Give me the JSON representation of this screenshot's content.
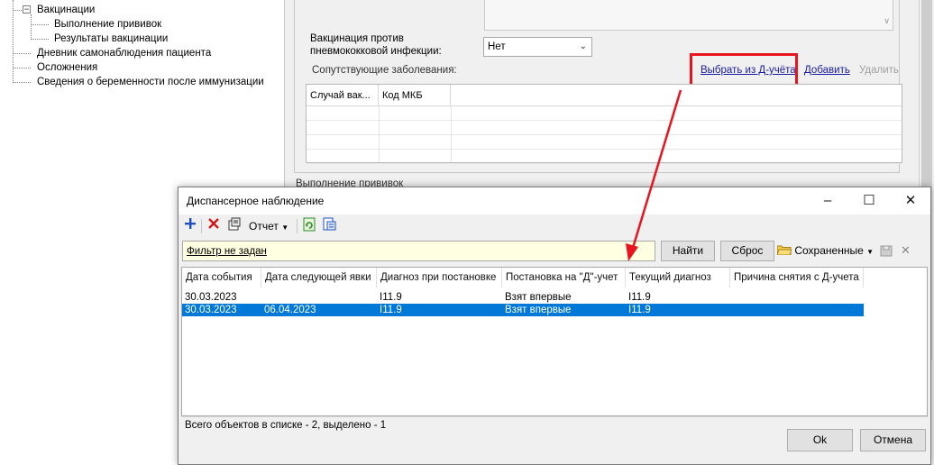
{
  "tree": {
    "items": [
      {
        "label": "Вакцинации",
        "level": 1
      },
      {
        "label": "Выполнение прививок",
        "level": 2
      },
      {
        "label": "Результаты вакцинации",
        "level": 2
      },
      {
        "label": "Дневник самонаблюдения пациента",
        "level": 1
      },
      {
        "label": "Осложнения",
        "level": 1
      },
      {
        "label": "Сведения о беременности после иммунизации",
        "level": 1
      }
    ],
    "expander_symbol": "−"
  },
  "form": {
    "vaccination_label": "Вакцинация против пневмококковой инфекции:",
    "vaccination_value": "Нет",
    "comorbidities_label": "Сопутствующие заболевания:",
    "link_select_d": "Выбрать из Д-учёта",
    "link_add": "Добавить",
    "link_delete": "Удалить",
    "grid_columns": [
      "Случай вак...",
      "Код МКБ"
    ],
    "hidden_section_label": "Выполнение прививок"
  },
  "dialog": {
    "title": "Диспансерное наблюдение",
    "toolbar": {
      "report_label": "Отчет"
    },
    "filter_text": "Фильтр не задан",
    "find_button": "Найти",
    "reset_button": "Сброс",
    "saved_label": "Сохраненные",
    "columns": [
      "Дата события",
      "Дата следующей явки",
      "Диагноз при постановке",
      "Постановка на \"Д\"-учет",
      "Текущий диагноз",
      "Причина снятия с Д-учета"
    ],
    "rows": [
      {
        "event_date": "30.03.2023",
        "next_visit": "",
        "diag_initial": "I11.9",
        "registration": "Взят впервые",
        "current_diag": "I11.9",
        "removal_reason": "",
        "selected": false
      },
      {
        "event_date": "30.03.2023",
        "next_visit": "06.04.2023",
        "diag_initial": "I11.9",
        "registration": "Взят впервые",
        "current_diag": "I11.9",
        "removal_reason": "",
        "selected": true
      }
    ],
    "status": "Всего объектов в списке - 2, выделено - 1",
    "ok_button": "Ok",
    "cancel_button": "Отмена"
  },
  "colors": {
    "selection": "#0078d7",
    "highlight_box": "#e8141e",
    "link": "#1a1aa6",
    "filter_bg": "#ffffe1"
  }
}
